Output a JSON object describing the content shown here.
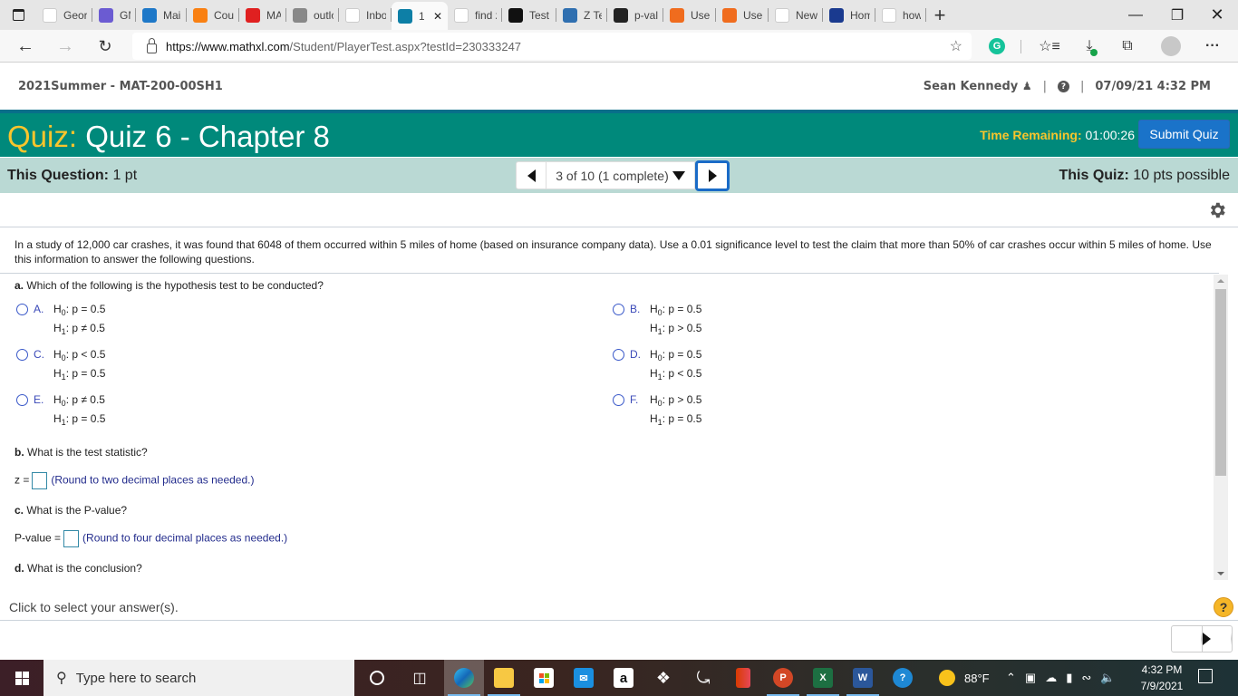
{
  "browser": {
    "tabs": [
      {
        "label": "Georg",
        "icon": "gmc-logo-icon",
        "color": "#ffffff"
      },
      {
        "label": "GMC",
        "icon": "gmc-portal-icon",
        "color": "#6b5bd2"
      },
      {
        "label": "Mail",
        "icon": "outlook-icon",
        "color": "#1e78c8"
      },
      {
        "label": "Cours",
        "icon": "moodle-icon",
        "color": "#f98012"
      },
      {
        "label": "MAT",
        "icon": "youtube-icon",
        "color": "#e02020"
      },
      {
        "label": "outlo",
        "icon": "file-icon",
        "color": "#888888"
      },
      {
        "label": "Inbox",
        "icon": "gmail-icon",
        "color": "#ffffff"
      },
      {
        "label": "1",
        "icon": "pearson-icon",
        "color": "#0d7fa6",
        "active": true
      },
      {
        "label": "find z",
        "icon": "bing-icon",
        "color": "#ffffff"
      },
      {
        "label": "Test S",
        "icon": "l-logo-icon",
        "color": "#111111"
      },
      {
        "label": "Z Tes",
        "icon": "ztest-icon",
        "color": "#2f6fb0"
      },
      {
        "label": "p-val",
        "icon": "pval-icon",
        "color": "#222222"
      },
      {
        "label": "Use T",
        "icon": "c-logo-icon",
        "color": "#f06c1e"
      },
      {
        "label": "Use T",
        "icon": "c-logo-icon",
        "color": "#f06c1e"
      },
      {
        "label": "New",
        "icon": "newtab-icon",
        "color": "#ffffff"
      },
      {
        "label": "Hom",
        "icon": "shield-star-icon",
        "color": "#1a3a8f"
      },
      {
        "label": "how",
        "icon": "bing-icon",
        "color": "#ffffff"
      }
    ],
    "url_host": "https://www.mathxl.com",
    "url_path": "/Student/PlayerTest.aspx?testId=230333247"
  },
  "course_header": {
    "course": "2021Summer - MAT-200-00SH1",
    "user": "Sean Kennedy",
    "datetime": "07/09/21 4:32 PM"
  },
  "quiz": {
    "label": "Quiz:",
    "title": "Quiz 6 - Chapter 8",
    "time_label": "Time Remaining:",
    "time_value": "01:00:26",
    "submit_label": "Submit Quiz",
    "this_question_label": "This Question:",
    "this_question_value": "1 pt",
    "nav_position": "3 of 10 (1 complete)",
    "this_quiz_label": "This Quiz:",
    "this_quiz_value": "10 pts possible"
  },
  "question": {
    "stem": "In a study of 12,000 car crashes, it was found that 6048 of them occurred within 5 miles of home (based on insurance company data). Use a 0.01 significance level to test the claim that more than 50% of car crashes occur within 5 miles of home. Use this information to answer the following questions.",
    "part_a_label": "a.",
    "part_a_text": "Which of the following is the hypothesis test to be conducted?",
    "options": [
      {
        "letter": "A.",
        "h0": "p = 0.5",
        "h1": "p ≠ 0.5"
      },
      {
        "letter": "B.",
        "h0": "p = 0.5",
        "h1": "p > 0.5"
      },
      {
        "letter": "C.",
        "h0": "p < 0.5",
        "h1": "p = 0.5"
      },
      {
        "letter": "D.",
        "h0": "p = 0.5",
        "h1": "p < 0.5"
      },
      {
        "letter": "E.",
        "h0": "p ≠ 0.5",
        "h1": "p = 0.5"
      },
      {
        "letter": "F.",
        "h0": "p > 0.5",
        "h1": "p = 0.5"
      }
    ],
    "h_label": "H",
    "h0_sub": "0",
    "h1_sub": "1",
    "part_b_label": "b.",
    "part_b_text": "What is the test statistic?",
    "z_label": "z =",
    "z_value": "",
    "z_hint": "(Round to two decimal places as needed.)",
    "part_c_label": "c.",
    "part_c_text": "What is the P-value?",
    "p_label": "P-value =",
    "p_value": "",
    "p_hint": "(Round to four decimal places as needed.)",
    "part_d_label": "d.",
    "part_d_text": "What is the conclusion?"
  },
  "footer": {
    "note": "Click to select your answer(s)."
  },
  "taskbar": {
    "search_placeholder": "Type here to search",
    "weather": "88°F",
    "time": "4:32 PM",
    "date": "7/9/2021"
  }
}
